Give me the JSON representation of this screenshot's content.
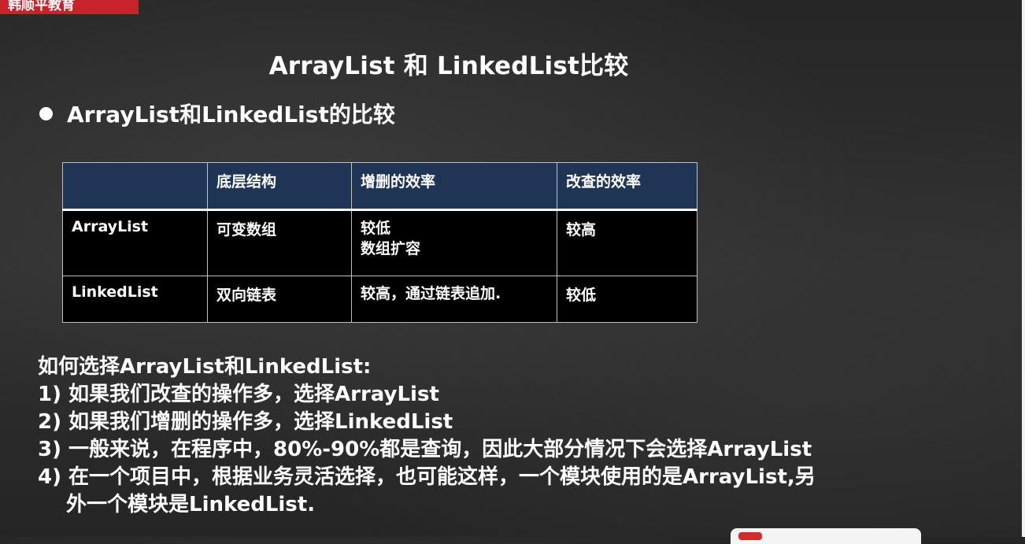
{
  "logo": "韩顺平教育",
  "slide_title": "ArrayList 和 LinkedList比较",
  "bullet": "ArrayList和LinkedList的比较",
  "table": {
    "headers": [
      "",
      "底层结构",
      "增删的效率",
      "改查的效率"
    ],
    "rows": [
      {
        "name": "ArrayList",
        "structure": "可变数组",
        "add_delete": [
          "较低",
          "数组扩容"
        ],
        "modify_query": "较高"
      },
      {
        "name": "LinkedList",
        "structure": "双向链表",
        "add_delete": [
          "较高，通过链表追加."
        ],
        "modify_query": "较低"
      }
    ]
  },
  "choose": {
    "heading": "如何选择ArrayList和LinkedList:",
    "items": [
      "1) 如果我们改查的操作多，选择ArrayList",
      "2) 如果我们增删的操作多，选择LinkedList",
      "3) 一般来说，在程序中，80%-90%都是查询，因此大部分情况下会选择ArrayList",
      "4) 在一个项目中，根据业务灵活选择，也可能这样，一个模块使用的是ArrayList,另"
    ],
    "item4_cont": "外一个模块是LinkedList."
  }
}
